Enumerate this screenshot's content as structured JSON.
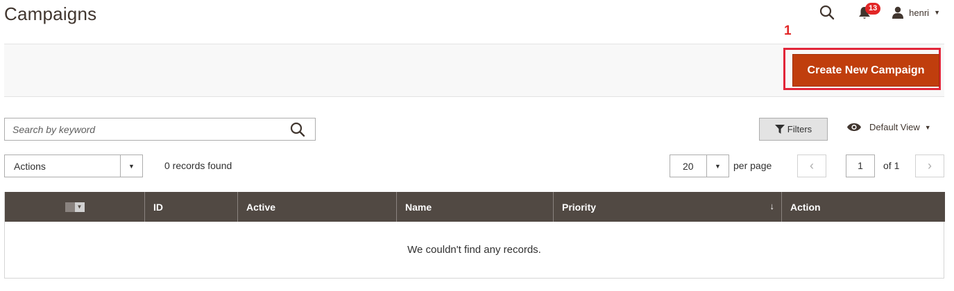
{
  "page": {
    "title": "Campaigns"
  },
  "header": {
    "notification_count": "13",
    "username": "henri"
  },
  "callout": {
    "number": "1"
  },
  "action_bar": {
    "create_button_label": "Create New Campaign"
  },
  "search": {
    "placeholder": "Search by keyword"
  },
  "toolbar": {
    "filters_label": "Filters",
    "view_label": "Default View",
    "actions_label": "Actions",
    "records_found": "0 records found",
    "per_page_value": "20",
    "per_page_label": "per page",
    "current_page": "1",
    "page_total": "of 1"
  },
  "grid": {
    "columns": [
      {
        "label": "ID"
      },
      {
        "label": "Active"
      },
      {
        "label": "Name"
      },
      {
        "label": "Priority",
        "sort_indicator": "↓"
      },
      {
        "label": "Action"
      }
    ],
    "empty_message": "We couldn't find any records."
  },
  "colors": {
    "primary_button": "#c03e0d",
    "highlight": "#e22639",
    "grid_header": "#514943",
    "badge": "#e22626"
  },
  "icons": {
    "search": "search-icon",
    "bell": "bell-icon",
    "user": "user-icon",
    "filter": "filter-icon",
    "eye": "eye-icon"
  }
}
